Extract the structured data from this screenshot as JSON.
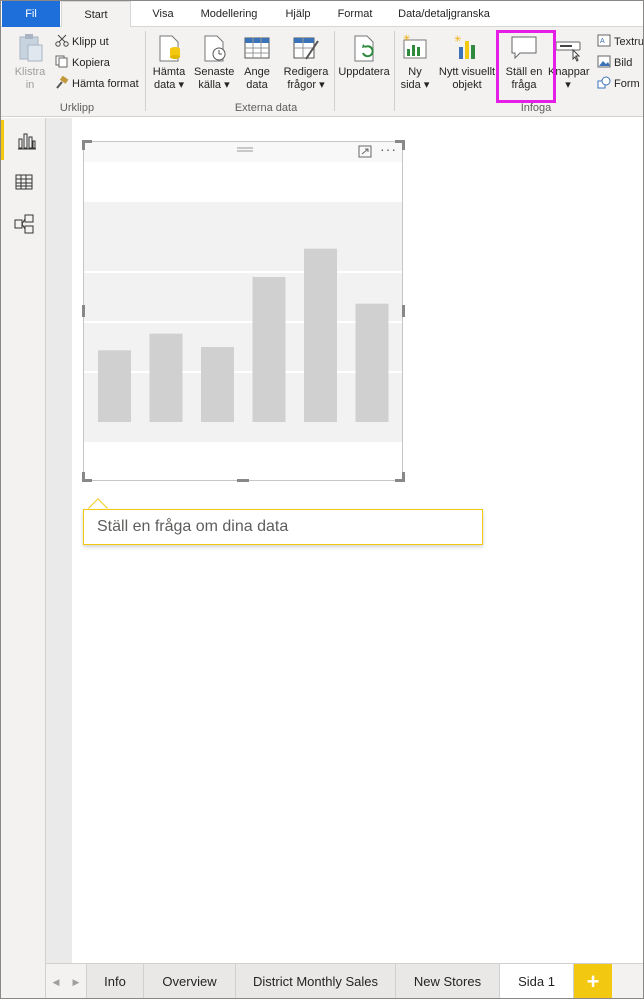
{
  "tabs": {
    "file": "Fil",
    "start": "Start",
    "view": "Visa",
    "modeling": "Modellering",
    "help": "Hjälp",
    "format": "Format",
    "data_drill": "Data/detaljgranska"
  },
  "ribbon": {
    "clipboard": {
      "paste_l1": "Klistra",
      "paste_l2": "in",
      "cut": "Klipp ut",
      "copy": "Kopiera",
      "format_painter": "Hämta format",
      "group": "Urklipp"
    },
    "external": {
      "get_data_l1": "Hämta",
      "get_data_l2": "data",
      "recent_l1": "Senaste",
      "recent_l2": "källa",
      "enter_l1": "Ange",
      "enter_l2": "data",
      "edit_l1": "Redigera",
      "edit_l2": "frågor",
      "refresh": "Uppdatera",
      "group": "Externa data"
    },
    "insert": {
      "new_page_l1": "Ny",
      "new_page_l2": "sida",
      "new_visual_l1": "Nytt visuellt",
      "new_visual_l2": "objekt",
      "ask_l1": "Ställ en",
      "ask_l2": "fråga",
      "buttons": "Knappar",
      "textbox": "Textru",
      "image": "Bild",
      "shapes": "Form",
      "group": "Infoga"
    }
  },
  "chart_data": {
    "type": "bar",
    "categories": [
      "",
      "",
      "",
      "",
      "",
      ""
    ],
    "values": [
      43,
      53,
      45,
      87,
      104,
      71
    ],
    "ylim": [
      0,
      120
    ],
    "grid": true,
    "title": "",
    "xlabel": "",
    "ylabel": ""
  },
  "qna": {
    "placeholder": "Ställ en fråga om dina data"
  },
  "pages": {
    "tabs": [
      "Info",
      "Overview",
      "District Monthly Sales",
      "New Stores",
      "Sida 1"
    ],
    "active_index": 4,
    "add": "+"
  },
  "colors": {
    "file_tab": "#1e6fd9",
    "highlight": "#e51ee5",
    "accent": "#f2c811",
    "bar": "#d0d0d0"
  }
}
